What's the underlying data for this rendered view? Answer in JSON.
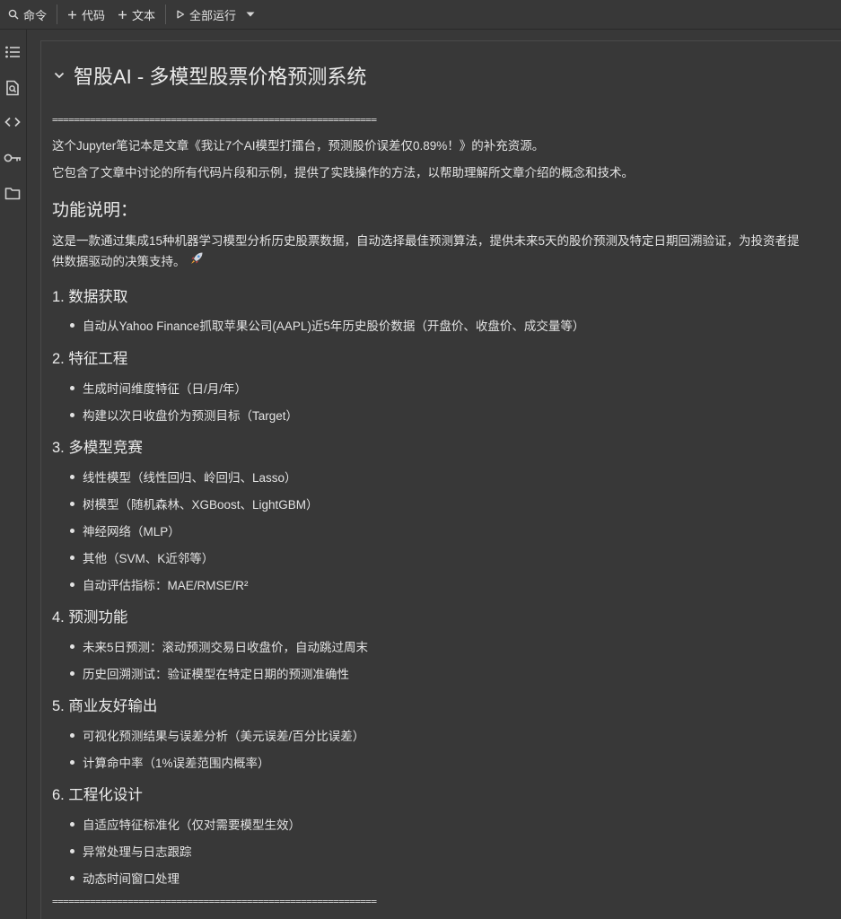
{
  "toolbar": {
    "command": "命令",
    "code": "代码",
    "text": "文本",
    "run_all": "全部运行"
  },
  "sidebar": {
    "icons": [
      "toc-icon",
      "find-icon",
      "code-snippets-icon",
      "secrets-key-icon",
      "folder-icon"
    ]
  },
  "notebook": {
    "title": "智股AI - 多模型股票价格预测系统",
    "rule_top": "============================================================",
    "rule_bottom": "============================================================",
    "intro1": "这个Jupyter笔记本是文章《我让7个AI模型打擂台，预测股价误差仅0.89%！》的补充资源。",
    "intro2": "它包含了文章中讨论的所有代码片段和示例，提供了实践操作的方法，以帮助理解所文章介绍的概念和技术。",
    "features_heading": "功能说明：",
    "features_desc_line1": "这是一款通过集成15种机器学习模型分析历史股票数据，自动选择最佳预测算法，提供未来5天的股价预测及特定日期回溯验证，为投资者提",
    "features_desc_line2": "供数据驱动的决策支持。",
    "sections": [
      {
        "heading": "1. 数据获取",
        "items": [
          "自动从Yahoo Finance抓取苹果公司(AAPL)近5年历史股价数据（开盘价、收盘价、成交量等）"
        ]
      },
      {
        "heading": "2. 特征工程",
        "items": [
          "生成时间维度特征（日/月/年）",
          "构建以次日收盘价为预测目标（Target）"
        ]
      },
      {
        "heading": "3. 多模型竞赛",
        "items": [
          "线性模型（线性回归、岭回归、Lasso）",
          "树模型（随机森林、XGBoost、LightGBM）",
          "神经网络（MLP）",
          "其他（SVM、K近邻等）",
          "自动评估指标：MAE/RMSE/R²"
        ]
      },
      {
        "heading": "4. 预测功能",
        "items": [
          "未来5日预测：滚动预测交易日收盘价，自动跳过周末",
          "历史回溯测试：验证模型在特定日期的预测准确性"
        ]
      },
      {
        "heading": "5. 商业友好输出",
        "items": [
          "可视化预测结果与误差分析（美元误差/百分比误差）",
          "计算命中率（1%误差范围内概率）"
        ]
      },
      {
        "heading": "6. 工程化设计",
        "items": [
          "自适应特征标准化（仅对需要模型生效）",
          "异常处理与日志跟踪",
          "动态时间窗口处理"
        ]
      }
    ]
  }
}
